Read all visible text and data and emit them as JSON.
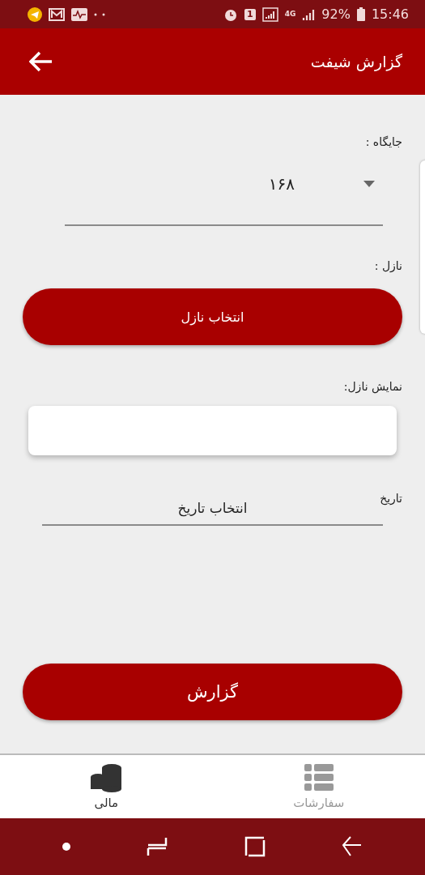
{
  "status_bar": {
    "sim": "1",
    "network": "4G",
    "battery": "92%",
    "time": "15:46"
  },
  "app_bar": {
    "title": "گزارش شیفت"
  },
  "form": {
    "station_label": "جایگاه :",
    "station_value": "۱۶۸",
    "nozzle_label": "نازل :",
    "nozzle_button": "انتخاب نازل",
    "nozzle_display_label": "نمایش نازل:",
    "date_label": "تاریخ",
    "date_value": "انتخاب تاریخ",
    "report_button": "گزارش"
  },
  "bottom_tabs": [
    {
      "label": "سفارشات",
      "kind": "list",
      "selected": false
    },
    {
      "label": "مالی",
      "kind": "coins",
      "selected": true
    }
  ]
}
